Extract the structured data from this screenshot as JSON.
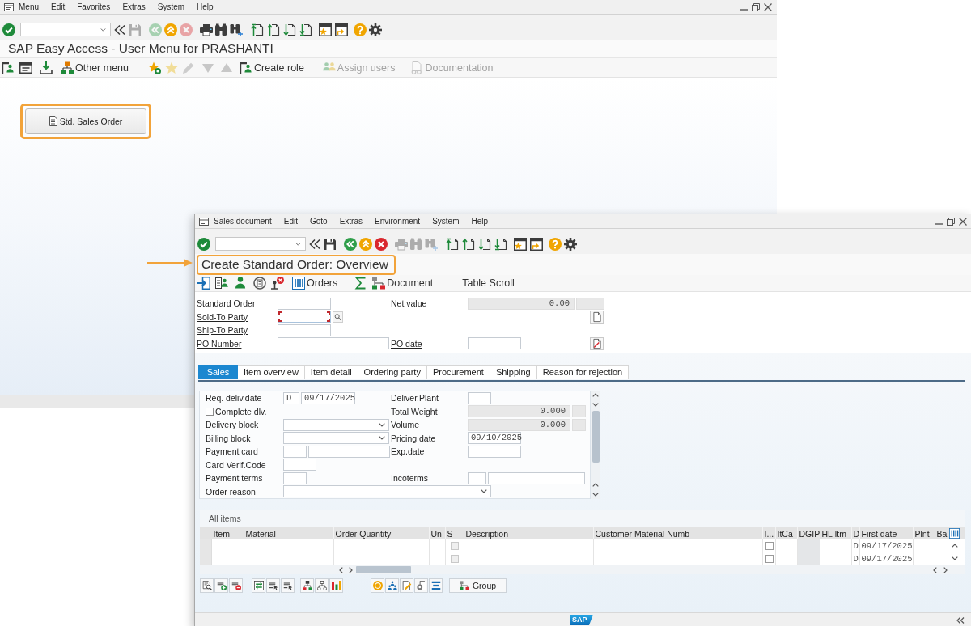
{
  "easy_access_window": {
    "menu": [
      "Menu",
      "Edit",
      "Favorites",
      "Extras",
      "System",
      "Help"
    ],
    "toolbar": [
      {
        "disabled": false
      },
      {
        "disabled": false
      },
      {
        "disabled": true
      },
      {
        "disabled": true
      },
      {
        "disabled": false
      },
      {
        "disabled": true
      },
      {
        "disabled": false
      },
      {
        "disabled": false
      },
      {
        "disabled": false
      },
      {
        "disabled": false
      },
      {
        "disabled": false
      },
      {
        "disabled": false
      },
      {
        "disabled": false
      },
      {
        "disabled": false
      },
      {
        "disabled": false
      },
      {
        "disabled": false
      },
      {
        "disabled": false
      }
    ],
    "title": "SAP Easy Access - User Menu for PRASHANTI",
    "app_toolbar": [
      {
        "kind": "icon",
        "disabled": false
      },
      {
        "kind": "icon",
        "disabled": false
      },
      {
        "kind": "icon",
        "disabled": false
      },
      {
        "kind": "button",
        "label": "Other menu",
        "disabled": false
      },
      {
        "kind": "icon",
        "disabled": false
      },
      {
        "kind": "icon",
        "disabled": true
      },
      {
        "kind": "icon",
        "disabled": true
      },
      {
        "kind": "icon",
        "disabled": true
      },
      {
        "kind": "icon",
        "disabled": true
      },
      {
        "kind": "button",
        "label": "Create role",
        "disabled": false
      },
      {
        "kind": "button",
        "label": "Assign users",
        "disabled": true
      },
      {
        "kind": "button",
        "label": "Documentation",
        "disabled": true
      }
    ],
    "shortcut_button": {
      "label": "Std. Sales Order",
      "highlighted": true
    }
  },
  "order_window": {
    "menu": [
      "Sales document",
      "Edit",
      "Goto",
      "Extras",
      "Environment",
      "System",
      "Help"
    ],
    "toolbar": [
      {
        "disabled": false
      },
      {
        "disabled": false
      },
      {
        "disabled": false
      },
      {
        "disabled": false
      },
      {
        "disabled": false
      },
      {
        "disabled": false
      },
      {
        "disabled": true
      },
      {
        "disabled": true
      },
      {
        "disabled": true
      },
      {
        "disabled": false
      },
      {
        "disabled": false
      },
      {
        "disabled": false
      },
      {
        "disabled": false
      },
      {
        "disabled": false
      },
      {
        "disabled": false
      },
      {
        "disabled": false
      },
      {
        "disabled": false
      }
    ],
    "title": {
      "text": "Create Standard Order: Overview",
      "highlighted": true
    },
    "app_toolbar": [
      {
        "kind": "icon",
        "disabled": false
      },
      {
        "kind": "icon",
        "disabled": false
      },
      {
        "kind": "icon",
        "disabled": false
      },
      {
        "kind": "icon",
        "disabled": false
      },
      {
        "kind": "icon",
        "disabled": false
      },
      {
        "kind": "button",
        "label": "Orders",
        "disabled": false
      },
      {
        "kind": "icon",
        "disabled": false
      },
      {
        "kind": "button",
        "label": "Document",
        "disabled": false
      },
      {
        "kind": "button",
        "label": "Table Scroll",
        "disabled": false
      }
    ],
    "header": [
      {
        "fields": [
          {
            "kind": "input",
            "label": "Standard Order",
            "link": false,
            "disabled": false,
            "focused": false
          },
          {
            "kind": "amount",
            "label": "Net value",
            "link": false,
            "value": "0.00",
            "disabled": true,
            "focused": false
          }
        ]
      },
      {
        "fields": [
          {
            "kind": "input",
            "label": "Sold-To Party",
            "link": true,
            "disabled": false,
            "focused": true
          }
        ]
      },
      {
        "fields": [
          {
            "kind": "input",
            "label": "Ship-To Party",
            "link": true,
            "disabled": false,
            "focused": false
          }
        ]
      },
      {
        "fields": [
          {
            "kind": "input",
            "label": "PO Number",
            "link": true,
            "disabled": false,
            "focused": false
          },
          {
            "kind": "input",
            "label": "PO date",
            "link": true,
            "disabled": false,
            "focused": false
          }
        ]
      }
    ],
    "tabs": [
      {
        "label": "Sales",
        "selected": true
      },
      {
        "label": "Item overview",
        "selected": false
      },
      {
        "label": "Item detail",
        "selected": false
      },
      {
        "label": "Ordering party",
        "selected": false
      },
      {
        "label": "Procurement",
        "selected": false
      },
      {
        "label": "Shipping",
        "selected": false
      },
      {
        "label": "Reason for rejection",
        "selected": false
      }
    ],
    "sales_tab": [
      {
        "fields": [
          {
            "kind": "pair",
            "label": "Req. deliv.date",
            "values": [
              "D",
              "09/17/2025"
            ],
            "disabled": false
          },
          {
            "kind": "input",
            "label": "Deliver.Plant",
            "disabled": false
          }
        ]
      },
      {
        "fields": [
          {
            "kind": "checkbox",
            "label": "Complete dlv.",
            "checked": false
          },
          {
            "kind": "amount",
            "label": "Total Weight",
            "value": "0.000",
            "disabled": true
          }
        ]
      },
      {
        "fields": [
          {
            "kind": "dropdown",
            "label": "Delivery block"
          },
          {
            "kind": "amount",
            "label": "Volume",
            "value": "0.000",
            "disabled": true
          }
        ]
      },
      {
        "fields": [
          {
            "kind": "dropdown",
            "label": "Billing block"
          },
          {
            "kind": "input",
            "label": "Pricing date",
            "value": "09/10/2025",
            "disabled": false
          }
        ]
      },
      {
        "fields": [
          {
            "kind": "pair",
            "label": "Payment card",
            "disabled": false
          },
          {
            "kind": "input",
            "label": "Exp.date",
            "disabled": false
          }
        ]
      },
      {
        "fields": [
          {
            "kind": "input",
            "label": "Card Verif.Code",
            "disabled": false
          }
        ]
      },
      {
        "fields": [
          {
            "kind": "input",
            "label": "Payment terms",
            "disabled": false
          },
          {
            "kind": "pair",
            "label": "Incoterms",
            "disabled": false
          }
        ]
      },
      {
        "fields": [
          {
            "kind": "dropdown",
            "label": "Order reason"
          }
        ]
      }
    ],
    "items_table": {
      "title": "All items",
      "columns": [
        {
          "label": "Item",
          "disabled": false
        },
        {
          "label": "Material",
          "disabled": false
        },
        {
          "label": "Order Quantity",
          "disabled": false
        },
        {
          "label": "Un",
          "disabled": false
        },
        {
          "label": "S",
          "disabled": false
        },
        {
          "label": "Description",
          "disabled": false
        },
        {
          "label": "Customer Material Numb",
          "disabled": false
        },
        {
          "label": "I...",
          "disabled": false
        },
        {
          "label": "ItCa",
          "disabled": false
        },
        {
          "label": "DGIP",
          "disabled": true
        },
        {
          "label": "HL Itm",
          "disabled": false
        },
        {
          "label": "D",
          "disabled": false
        },
        {
          "label": "First date",
          "disabled": false
        },
        {
          "label": "Plnt",
          "disabled": false
        },
        {
          "label": "Ba",
          "disabled": false
        }
      ],
      "rows": [
        {
          "s": {
            "checked": false,
            "disabled": true
          },
          "i": {
            "checked": false,
            "disabled": false
          },
          "d": "D",
          "first_date": "09/17/2025"
        },
        {
          "s": {
            "checked": false,
            "disabled": true
          },
          "i": {
            "checked": false,
            "disabled": false
          },
          "d": "D",
          "first_date": "09/17/2025"
        }
      ]
    },
    "item_toolbar": {
      "group_button": "Group"
    },
    "status_bar": {
      "logo": "SAP"
    }
  }
}
